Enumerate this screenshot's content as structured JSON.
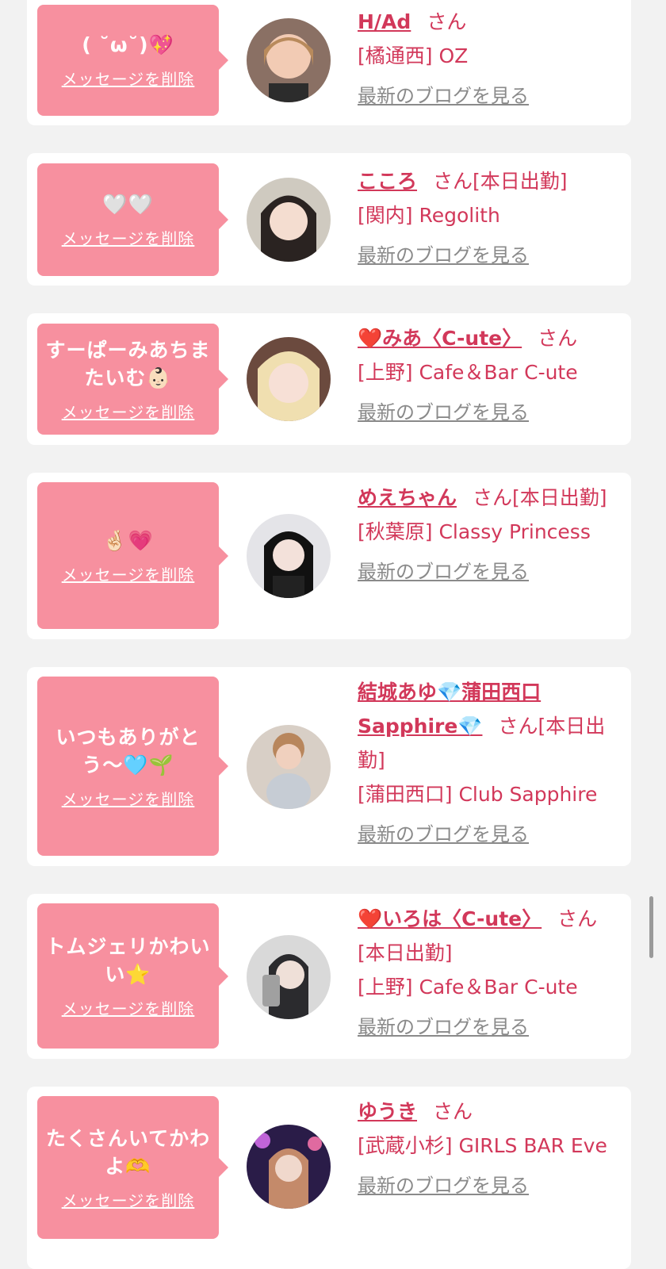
{
  "delete_label": "メッセージを削除",
  "blog_label": "最新のブログを見る",
  "san_label": "さん",
  "colors": {
    "bubble": "#f7909f",
    "accent": "#d2385a",
    "link_gray": "#8a8a8a"
  },
  "entries": [
    {
      "message": "( ˘ω˘)💖",
      "name": "H/Ad",
      "status": "",
      "area": "[橘通西] OZ"
    },
    {
      "message": "🤍🤍",
      "name": "こころ",
      "status": "[本日出勤]",
      "area": "[関内] Regolith"
    },
    {
      "message": "すーぱーみあちまたいむ👶🏻",
      "name": "❤️みあ〈C-ute〉",
      "status": "",
      "area": "[上野] Cafe＆Bar C-ute"
    },
    {
      "message": "🤞🏻💗",
      "name": "めえちゃん",
      "status": "[本日出勤]",
      "area": "[秋葉原] Classy Princess"
    },
    {
      "message": "いつもありがとう〜🩵🌱",
      "name": "結城あゆ💎蒲田西口Sapphire💎",
      "status": "[本日出勤]",
      "area": "[蒲田西口] Club Sapphire"
    },
    {
      "message": "トムジェリかわいい⭐️",
      "name": "❤️いろは〈C-ute〉",
      "status": "[本日出勤]",
      "area": "[上野] Cafe＆Bar C-ute"
    },
    {
      "message": "たくさんいてかわよ🫶",
      "name": "ゆうき",
      "status": "",
      "area": "[武蔵小杉] GIRLS BAR Eve"
    }
  ]
}
